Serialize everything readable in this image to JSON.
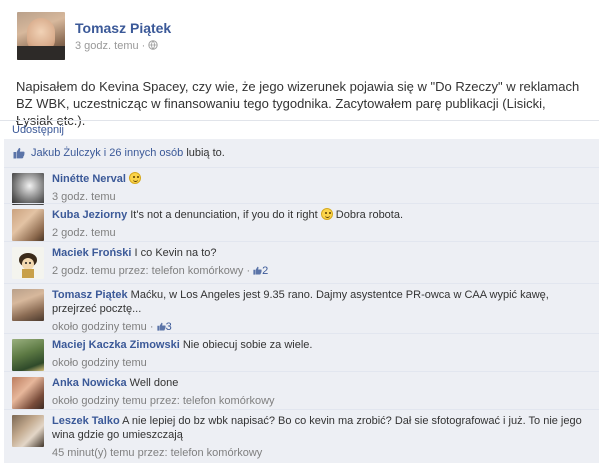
{
  "post": {
    "author": "Tomasz Piątek",
    "time": "3 godz. temu",
    "separator": "·",
    "audience_icon": "globe-icon",
    "body": "Napisałem do Kevina Spacey, czy wie, że jego wizerunek pojawia się w \"Do Rzeczy\" w reklamach BZ WBK, uczestnicząc w finansowaniu tego tygodnika. Zacytowałem parę publikacji (Lisicki, Łysiak etc.)."
  },
  "actions": {
    "share_label": "Udostępnij"
  },
  "likes": {
    "text_prefix": "Jakub Żulczyk i 26 innych osób",
    "text_suffix": "lubią to.",
    "icon": "thumbs-up-icon"
  },
  "colors": {
    "link": "#3b5998",
    "feedback_bg": "#edeff4",
    "meta": "#808080"
  },
  "comments": [
    {
      "name": "Ninétte Nerval",
      "text": "",
      "emoji": "smiley-icon",
      "meta": "3 godz. temu",
      "likes": ""
    },
    {
      "name": "Kuba Jeziorny",
      "text": "It's not a denunciation, if you do it right",
      "emoji": "smiley-icon",
      "text_after": "Dobra robota.",
      "meta": "2 godz. temu",
      "likes": ""
    },
    {
      "name": "Maciek Froński",
      "text": "I co Kevin na to?",
      "meta": "2 godz. temu przez: telefon komórkowy",
      "separator": "·",
      "likes": "2"
    },
    {
      "name": "Tomasz Piątek",
      "text": "Maćku, w Los Angeles jest 9.35 rano. Dajmy asystentce PR-owca w CAA wypić kawę, przejrzeć pocztę...",
      "meta": "około godziny temu",
      "separator": "·",
      "likes": "3"
    },
    {
      "name": "Maciej Kaczka Zimowski",
      "text": "Nie obiecuj sobie za wiele.",
      "meta": "około godziny temu",
      "likes": ""
    },
    {
      "name": "Anka Nowicka",
      "text": "Well done",
      "meta": "około godziny temu przez: telefon komórkowy",
      "likes": ""
    },
    {
      "name": "Leszek Talko",
      "text": "A nie lepiej do bz wbk napisać? Bo co kevin ma zrobić? Dał sie sfotografować i już. To nie jego wina gdzie go umieszczają",
      "meta": "45 minut(y) temu przez: telefon komórkowy",
      "likes": ""
    }
  ]
}
